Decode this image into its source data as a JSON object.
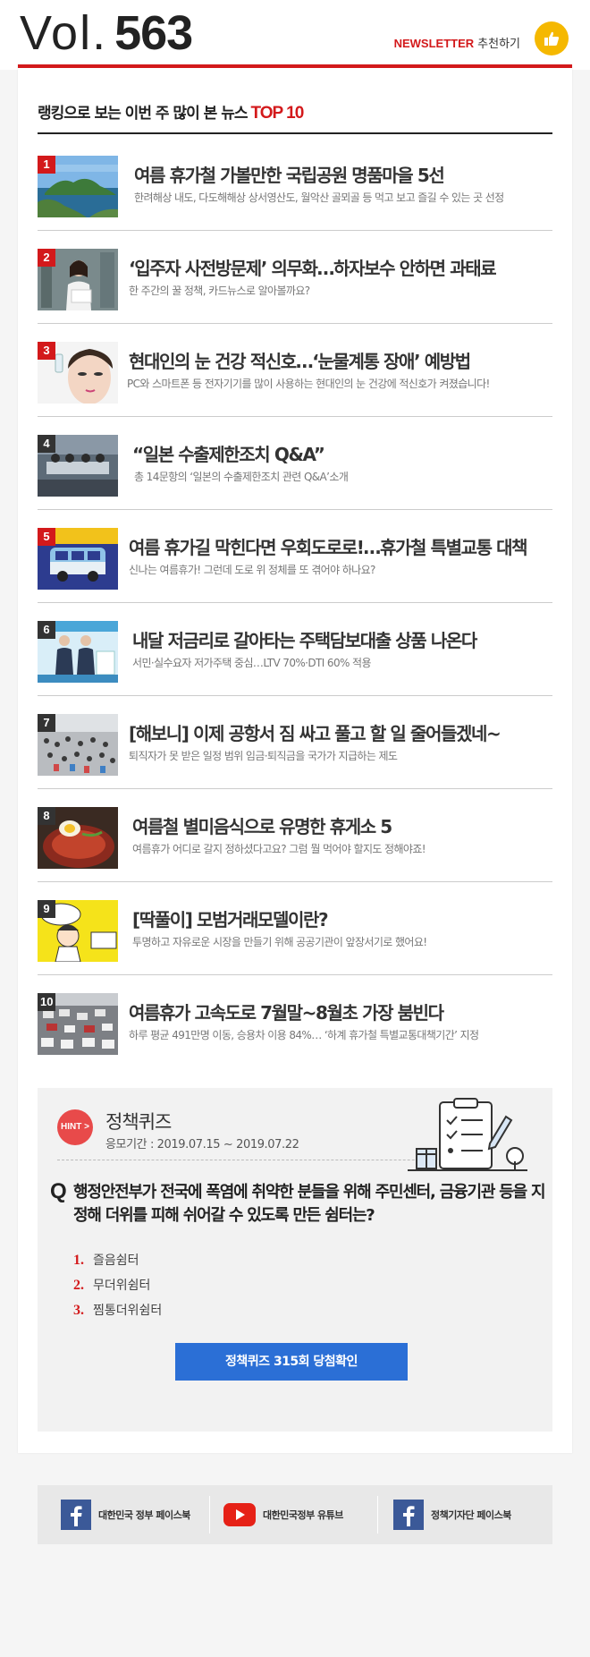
{
  "header": {
    "vol_label": "Vol.",
    "vol_number": "563",
    "newsletter_label": "NEWSLETTER",
    "recommend_label": "추천하기",
    "brand_red": "#d3191b",
    "thumb_color": "#f5b800"
  },
  "ranking": {
    "title": "랭킹으로 보는 이번 주 많이 본 뉴스",
    "title_highlight": "TOP 10",
    "items": [
      {
        "rank": "1",
        "title": "여름 휴가철 가볼만한 국립공원 명품마을 5선",
        "subtitle": "한려해상 내도, 다도해해상 상서영산도, 월악산 골뫼골 등 먹고 보고 즐길 수 있는 곳 선정",
        "thumb": "island-photo"
      },
      {
        "rank": "2",
        "title": "‘입주자 사전방문제’ 의무화…하자보수 안하면 과태료",
        "subtitle": "한 주간의 꿀 정책, 카드뉴스로 알아볼까요?",
        "thumb": "office-woman-photo"
      },
      {
        "rank": "3",
        "title": "현대인의 눈 건강 적신호…‘눈물계통 장애’ 예방법",
        "subtitle": "PC와 스마트폰 등 전자기기를 많이 사용하는 현대인의 눈 건강에 적신호가 켜졌습니다!",
        "thumb": "eye-drop-photo"
      },
      {
        "rank": "4",
        "title": "“일본 수출제한조치 Q&A”",
        "subtitle": "총 14문항의 ‘일본의 수출제한조치 관련 Q&A’소개",
        "thumb": "meeting-photo"
      },
      {
        "rank": "5",
        "title": "여름 휴가길 막힌다면 우회도로로!…휴가철 특별교통 대책",
        "subtitle": "신나는 여름휴가! 그런데 도로 위 정체를 또 겪어야 하나요?",
        "thumb": "van-illustration"
      },
      {
        "rank": "6",
        "title": "내달 저금리로 갈아타는 주택담보대출 상품 나온다",
        "subtitle": "서민·실수요자 저가주택 중심…LTV 70%·DTI 60% 적용",
        "thumb": "briefing-photo"
      },
      {
        "rank": "7",
        "title": "[해보니] 이제 공항서 짐 싸고 풀고 할 일 줄어들겠네~",
        "subtitle": "퇴직자가 못 받은 일정 범위 임금·퇴직금을 국가가 지급하는 제도",
        "thumb": "airport-photo"
      },
      {
        "rank": "8",
        "title": "여름철 별미음식으로 유명한 휴게소 5",
        "subtitle": "여름휴가 어디로 갈지 정하셨다고요? 그럼 뭘 먹어야 할지도 정해야죠!",
        "thumb": "noodle-photo"
      },
      {
        "rank": "9",
        "title": "[딱풀이] 모범거래모델이란?",
        "subtitle": "투명하고 자유로운 시장을 만들기 위해 공공기관이 앞장서기로 했어요!",
        "thumb": "cartoon-illustration"
      },
      {
        "rank": "10",
        "title": "여름휴가 고속도로 7월말~8월초 가장 붐빈다",
        "subtitle": "하루 평균 491만명 이동, 승용차 이용 84%… ‘하계 휴가철 특별교통대책기간’ 지정",
        "thumb": "traffic-photo"
      }
    ]
  },
  "quiz": {
    "hint_label": "HINT >",
    "title": "정책퀴즈",
    "period": "응모기간 : 2019.07.15 ~ 2019.07.22",
    "question_mark": "Q",
    "question": "행정안전부가 전국에 폭염에 취약한 분들을 위해 주민센터, 금융기관 등을 지정해 더위를 피해 쉬어갈 수 있도록 만든 쉼터는?",
    "options": [
      {
        "num": "1.",
        "text": "즐음쉼터"
      },
      {
        "num": "2.",
        "text": "무더위쉼터"
      },
      {
        "num": "3.",
        "text": "찜통더위쉼터"
      }
    ],
    "button_label": "정책퀴즈 315회 당첨확인",
    "button_color": "#2b6fd6"
  },
  "social": {
    "links": [
      {
        "label": "대한민국 정부 페이스북",
        "icon": "facebook-icon"
      },
      {
        "label": "대한민국정부 유튜브",
        "icon": "youtube-icon"
      },
      {
        "label": "정책기자단 페이스북",
        "icon": "facebook-icon"
      }
    ]
  }
}
